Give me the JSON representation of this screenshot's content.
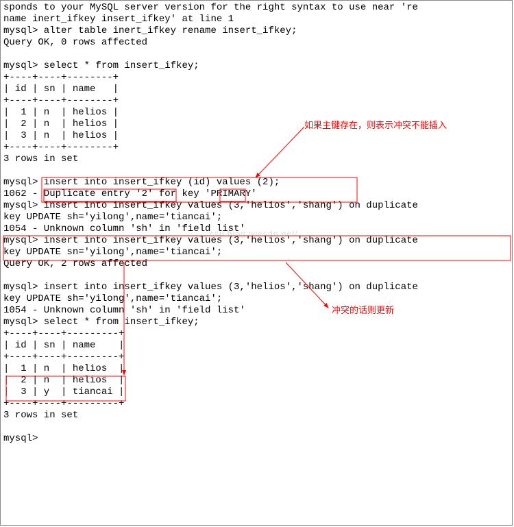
{
  "terminal_text": "sponds to your MySQL server version for the right syntax to use near 're\nname inert_ifkey insert_ifkey' at line 1\nmysql> alter table inert_ifkey rename insert_ifkey;\nQuery OK, 0 rows affected\n\nmysql> select * from insert_ifkey;\n+----+----+--------+\n| id | sn | name   |\n+----+----+--------+\n|  1 | n  | helios |\n|  2 | n  | helios |\n|  3 | n  | helios |\n+----+----+--------+\n3 rows in set\n\nmysql> insert into insert_ifkey (id) values (2);\n1062 - Duplicate entry '2' for key 'PRIMARY'\nmysql> insert into insert_ifkey values (3,'helios','shang') on duplicate\nkey UPDATE sh='yilong',name='tiancai';\n1054 - Unknown column 'sh' in 'field list'\nmysql> insert into insert_ifkey values (3,'helios','shang') on duplicate\nkey UPDATE sn='yilong',name='tiancai';\nQuery OK, 2 rows affected\n\nmysql> insert into insert_ifkey values (3,'helios','shang') on duplicate\nkey UPDATE sh='yilong',name='tiancai';\n1054 - Unknown column 'sh' in 'field list'\nmysql> select * from insert_ifkey;\n+----+----+---------+\n| id | sn | name    |\n+----+----+---------+\n|  1 | n  | helios  |\n|  2 | n  | helios  |\n|  3 | y  | tiancai |\n+----+----+---------+\n3 rows in set\n\nmysql> ",
  "annot1": "如果主键存在，则表示冲突不能插入",
  "annot2": "冲突的话则更新",
  "watermark": "csp.hiog.wiesdn.net/"
}
